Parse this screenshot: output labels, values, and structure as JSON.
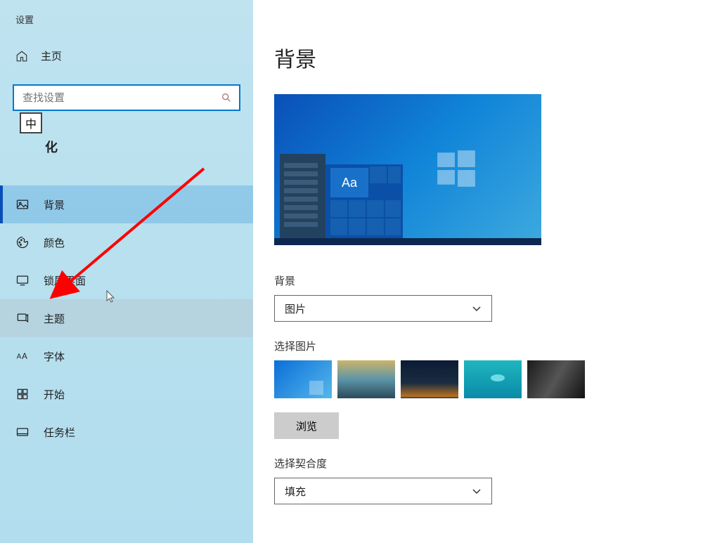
{
  "sidebar": {
    "title": "设置",
    "home_label": "主页",
    "search_placeholder": "查找设置",
    "ime_badge": "中",
    "category_partial": "化",
    "items": [
      {
        "icon": "background",
        "label": "背景",
        "selected": true
      },
      {
        "icon": "colors",
        "label": "颜色"
      },
      {
        "icon": "lockscreen",
        "label": "锁屏界面"
      },
      {
        "icon": "themes",
        "label": "主题",
        "highlight": true
      },
      {
        "icon": "fonts",
        "label": "字体"
      },
      {
        "icon": "start",
        "label": "开始"
      },
      {
        "icon": "taskbar",
        "label": "任务栏"
      }
    ]
  },
  "main": {
    "title": "背景",
    "preview_tile_text": "Aa",
    "bg_label": "背景",
    "bg_dropdown_value": "图片",
    "choose_pic_label": "选择图片",
    "browse_label": "浏览",
    "fit_label": "选择契合度",
    "fit_dropdown_value": "填充"
  }
}
